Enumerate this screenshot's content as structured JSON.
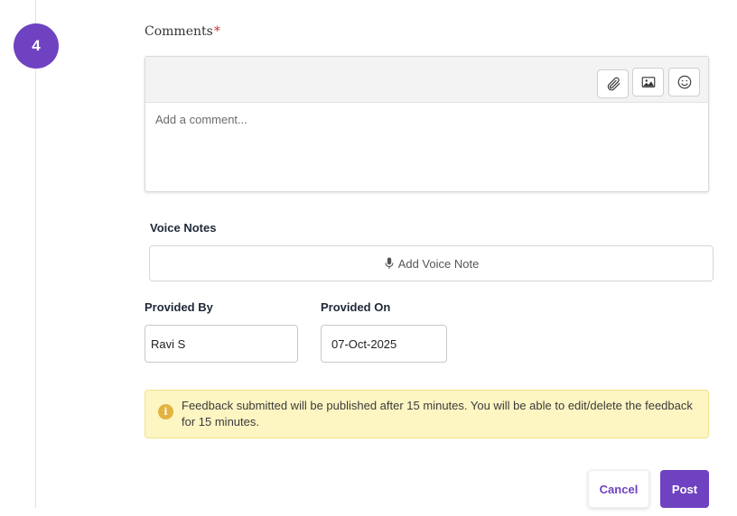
{
  "step": {
    "number": "4"
  },
  "comments": {
    "label": "Comments",
    "required_mark": "*",
    "placeholder": "Add a comment...",
    "toolbar": {
      "attach_icon": "paperclip-icon",
      "image_icon": "image-icon",
      "emoji_icon": "smiley-icon"
    }
  },
  "voice_notes": {
    "label": "Voice Notes",
    "button_label": "Add Voice Note",
    "button_icon": "microphone-icon"
  },
  "provided_by": {
    "label": "Provided By",
    "value": "Ravi S"
  },
  "provided_on": {
    "label": "Provided On",
    "value": "07-Oct-2025"
  },
  "notice": {
    "icon": "info-icon",
    "text": "Feedback submitted will be published after 15 minutes. You will be able to edit/delete the feedback for 15 minutes."
  },
  "actions": {
    "cancel_label": "Cancel",
    "post_label": "Post"
  },
  "colors": {
    "accent": "#6f42c1",
    "required": "#d32f2f",
    "notice_bg": "#fdf5c2",
    "notice_icon": "#e3b341"
  }
}
